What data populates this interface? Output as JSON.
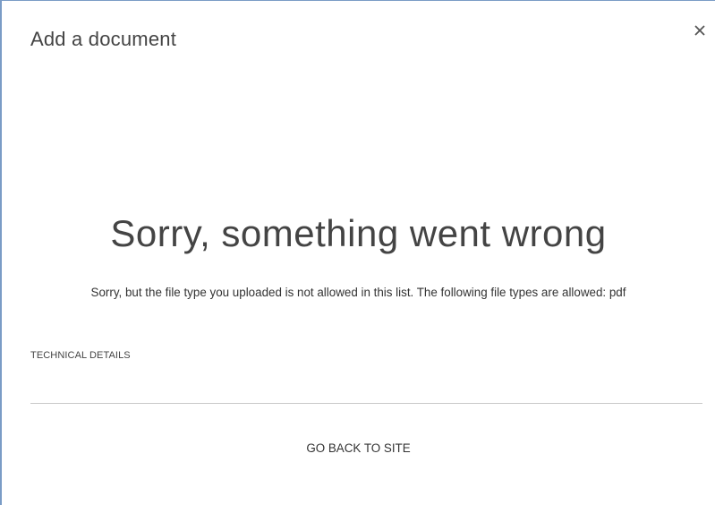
{
  "dialog": {
    "title": "Add a document",
    "close_icon": "close-icon"
  },
  "error": {
    "heading": "Sorry, something went wrong",
    "message": "Sorry, but the file type you uploaded is not allowed in this list. The following file types are allowed: pdf"
  },
  "links": {
    "technical_details": "TECHNICAL DETAILS",
    "go_back": "GO BACK TO SITE"
  },
  "colors": {
    "border_accent": "#7a9cc6",
    "text": "#444444",
    "divider": "#c8c8c8"
  }
}
